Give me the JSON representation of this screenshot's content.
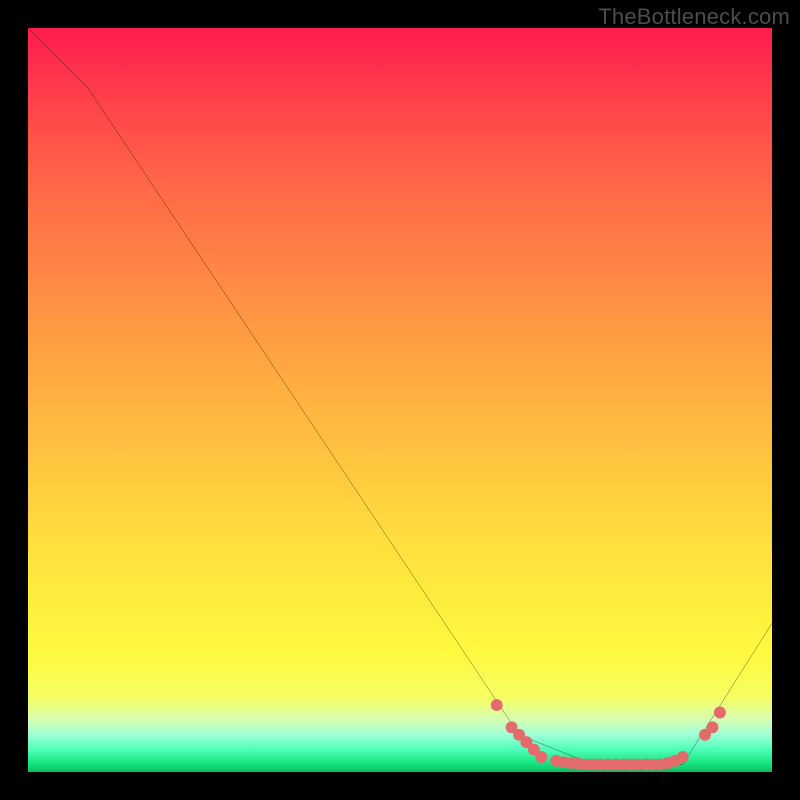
{
  "attribution": "TheBottleneck.com",
  "chart_data": {
    "type": "line",
    "title": "",
    "xlabel": "",
    "ylabel": "",
    "xlim": [
      0,
      100
    ],
    "ylim": [
      0,
      100
    ],
    "line": {
      "points": [
        {
          "x": 0,
          "y": 100
        },
        {
          "x": 8,
          "y": 92
        },
        {
          "x": 66,
          "y": 5
        },
        {
          "x": 76,
          "y": 1
        },
        {
          "x": 88,
          "y": 1
        },
        {
          "x": 100,
          "y": 20
        }
      ],
      "color": "#000000",
      "width": 2
    },
    "markers": {
      "color": "#e36b6b",
      "radius": 6,
      "points": [
        {
          "x": 63,
          "y": 9
        },
        {
          "x": 65,
          "y": 6
        },
        {
          "x": 66,
          "y": 5
        },
        {
          "x": 67,
          "y": 4
        },
        {
          "x": 68,
          "y": 3
        },
        {
          "x": 69,
          "y": 2
        },
        {
          "x": 71,
          "y": 1.5
        },
        {
          "x": 72,
          "y": 1.3
        },
        {
          "x": 73,
          "y": 1.2
        },
        {
          "x": 74,
          "y": 1.1
        },
        {
          "x": 75,
          "y": 1
        },
        {
          "x": 76,
          "y": 1
        },
        {
          "x": 77,
          "y": 1
        },
        {
          "x": 78,
          "y": 1
        },
        {
          "x": 79,
          "y": 1
        },
        {
          "x": 80,
          "y": 1
        },
        {
          "x": 81,
          "y": 1
        },
        {
          "x": 82,
          "y": 1
        },
        {
          "x": 83,
          "y": 1
        },
        {
          "x": 84,
          "y": 1
        },
        {
          "x": 85,
          "y": 1
        },
        {
          "x": 86,
          "y": 1.2
        },
        {
          "x": 87,
          "y": 1.5
        },
        {
          "x": 88,
          "y": 2
        },
        {
          "x": 91,
          "y": 5
        },
        {
          "x": 92,
          "y": 6
        },
        {
          "x": 93,
          "y": 8
        }
      ]
    },
    "background_gradient": {
      "top": "#ff1a4e",
      "upper_mid": "#ffb740",
      "lower_mid": "#fff93f",
      "bottom": "#12e27c"
    }
  }
}
